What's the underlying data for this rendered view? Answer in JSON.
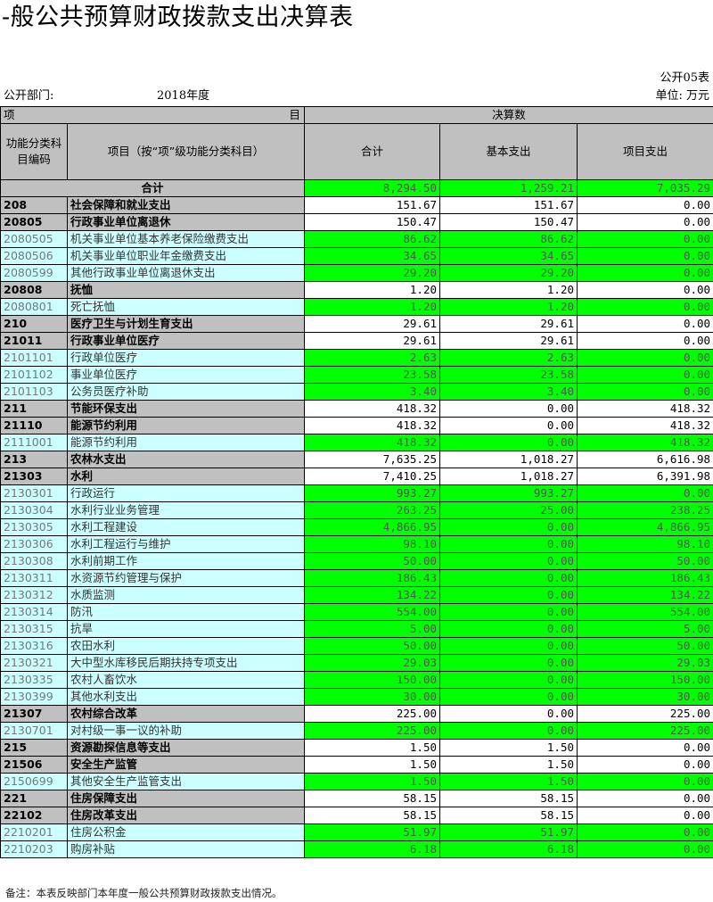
{
  "title": "-般公共预算财政拨款支出决算表",
  "table_no": "公开05表",
  "dept_label": "公开部门:",
  "year": "2018年度",
  "unit": "单位: 万元",
  "header": {
    "item": "项",
    "item_right": "目",
    "budget": "决算数",
    "code_col": "功能分类科目编码",
    "name_col": "项目（按“项”级功能分类科目）",
    "total_col": "合计",
    "basic_col": "基本支出",
    "project_col": "项目支出"
  },
  "total_row": {
    "label": "合计",
    "total": "8,294.50",
    "basic": "1,259.21",
    "project": "7,035.29"
  },
  "rows": [
    {
      "level": "lvl1",
      "code": "208",
      "name": "社会保障和就业支出",
      "total": "151.67",
      "basic": "151.67",
      "project": "0.00"
    },
    {
      "level": "lvl2",
      "code": "20805",
      "name": "行政事业单位离退休",
      "total": "150.47",
      "basic": "150.47",
      "project": "0.00"
    },
    {
      "level": "lvl3",
      "code": "2080505",
      "name": "机关事业单位基本养老保险缴费支出",
      "total": "86.62",
      "basic": "86.62",
      "project": "0.00"
    },
    {
      "level": "lvl3",
      "code": "2080506",
      "name": "机关事业单位职业年金缴费支出",
      "total": "34.65",
      "basic": "34.65",
      "project": "0.00"
    },
    {
      "level": "lvl3",
      "code": "2080599",
      "name": "其他行政事业单位离退休支出",
      "total": "29.20",
      "basic": "29.20",
      "project": "0.00"
    },
    {
      "level": "lvl2",
      "code": "20808",
      "name": "抚恤",
      "total": "1.20",
      "basic": "1.20",
      "project": "0.00"
    },
    {
      "level": "lvl3",
      "code": "2080801",
      "name": "死亡抚恤",
      "total": "1.20",
      "basic": "1.20",
      "project": "0.00"
    },
    {
      "level": "lvl1",
      "code": "210",
      "name": "医疗卫生与计划生育支出",
      "total": "29.61",
      "basic": "29.61",
      "project": "0.00"
    },
    {
      "level": "lvl2",
      "code": "21011",
      "name": "行政事业单位医疗",
      "total": "29.61",
      "basic": "29.61",
      "project": "0.00"
    },
    {
      "level": "lvl3",
      "code": "2101101",
      "name": "行政单位医疗",
      "total": "2.63",
      "basic": "2.63",
      "project": "0.00"
    },
    {
      "level": "lvl3",
      "code": "2101102",
      "name": "事业单位医疗",
      "total": "23.58",
      "basic": "23.58",
      "project": "0.00"
    },
    {
      "level": "lvl3",
      "code": "2101103",
      "name": "公务员医疗补助",
      "total": "3.40",
      "basic": "3.40",
      "project": "0.00"
    },
    {
      "level": "lvl1",
      "code": "211",
      "name": "节能环保支出",
      "total": "418.32",
      "basic": "0.00",
      "project": "418.32"
    },
    {
      "level": "lvl2",
      "code": "21110",
      "name": "能源节约利用",
      "total": "418.32",
      "basic": "0.00",
      "project": "418.32"
    },
    {
      "level": "lvl3",
      "code": "2111001",
      "name": "能源节约利用",
      "total": "418.32",
      "basic": "0.00",
      "project": "418.32"
    },
    {
      "level": "lvl1",
      "code": "213",
      "name": "农林水支出",
      "total": "7,635.25",
      "basic": "1,018.27",
      "project": "6,616.98"
    },
    {
      "level": "lvl2",
      "code": "21303",
      "name": "水利",
      "total": "7,410.25",
      "basic": "1,018.27",
      "project": "6,391.98"
    },
    {
      "level": "lvl3",
      "code": "2130301",
      "name": "行政运行",
      "total": "993.27",
      "basic": "993.27",
      "project": "0.00"
    },
    {
      "level": "lvl3",
      "code": "2130304",
      "name": "水利行业业务管理",
      "total": "263.25",
      "basic": "25.00",
      "project": "238.25"
    },
    {
      "level": "lvl3",
      "code": "2130305",
      "name": "水利工程建设",
      "total": "4,866.95",
      "basic": "0.00",
      "project": "4,866.95"
    },
    {
      "level": "lvl3",
      "code": "2130306",
      "name": "水利工程运行与维护",
      "total": "98.10",
      "basic": "0.00",
      "project": "98.10"
    },
    {
      "level": "lvl3",
      "code": "2130308",
      "name": "水利前期工作",
      "total": "50.00",
      "basic": "0.00",
      "project": "50.00"
    },
    {
      "level": "lvl3",
      "code": "2130311",
      "name": "水资源节约管理与保护",
      "total": "186.43",
      "basic": "0.00",
      "project": "186.43"
    },
    {
      "level": "lvl3",
      "code": "2130312",
      "name": "水质监测",
      "total": "134.22",
      "basic": "0.00",
      "project": "134.22"
    },
    {
      "level": "lvl3",
      "code": "2130314",
      "name": "防汛",
      "total": "554.00",
      "basic": "0.00",
      "project": "554.00"
    },
    {
      "level": "lvl3",
      "code": "2130315",
      "name": "抗旱",
      "total": "5.00",
      "basic": "0.00",
      "project": "5.00"
    },
    {
      "level": "lvl3",
      "code": "2130316",
      "name": "农田水利",
      "total": "50.00",
      "basic": "0.00",
      "project": "50.00"
    },
    {
      "level": "lvl3",
      "code": "2130321",
      "name": "大中型水库移民后期扶持专项支出",
      "total": "29.03",
      "basic": "0.00",
      "project": "29.03"
    },
    {
      "level": "lvl3",
      "code": "2130335",
      "name": "农村人畜饮水",
      "total": "150.00",
      "basic": "0.00",
      "project": "150.00"
    },
    {
      "level": "lvl3",
      "code": "2130399",
      "name": "其他水利支出",
      "total": "30.00",
      "basic": "0.00",
      "project": "30.00"
    },
    {
      "level": "lvl2",
      "code": "21307",
      "name": "农村综合改革",
      "total": "225.00",
      "basic": "0.00",
      "project": "225.00"
    },
    {
      "level": "lvl3",
      "code": "2130701",
      "name": "对村级一事一议的补助",
      "total": "225.00",
      "basic": "0.00",
      "project": "225.00"
    },
    {
      "level": "lvl1",
      "code": "215",
      "name": "资源勘探信息等支出",
      "total": "1.50",
      "basic": "1.50",
      "project": "0.00"
    },
    {
      "level": "lvl2",
      "code": "21506",
      "name": "安全生产监管",
      "total": "1.50",
      "basic": "1.50",
      "project": "0.00"
    },
    {
      "level": "lvl3",
      "code": "2150699",
      "name": "其他安全生产监管支出",
      "total": "1.50",
      "basic": "1.50",
      "project": "0.00"
    },
    {
      "level": "lvl1",
      "code": "221",
      "name": "住房保障支出",
      "total": "58.15",
      "basic": "58.15",
      "project": "0.00"
    },
    {
      "level": "lvl2",
      "code": "22102",
      "name": "住房改革支出",
      "total": "58.15",
      "basic": "58.15",
      "project": "0.00"
    },
    {
      "level": "lvl3",
      "code": "2210201",
      "name": "住房公积金",
      "total": "51.97",
      "basic": "51.97",
      "project": "0.00"
    },
    {
      "level": "lvl3",
      "code": "2210203",
      "name": "购房补贴",
      "total": "6.18",
      "basic": "6.18",
      "project": "0.00"
    }
  ],
  "note": "备注：本表反映部门本年度一般公共预算财政拨款支出情况。",
  "colors": {
    "header_gray": "#c0c0c0",
    "item_cyan": "#ccffff",
    "value_green": "#00ff00"
  }
}
